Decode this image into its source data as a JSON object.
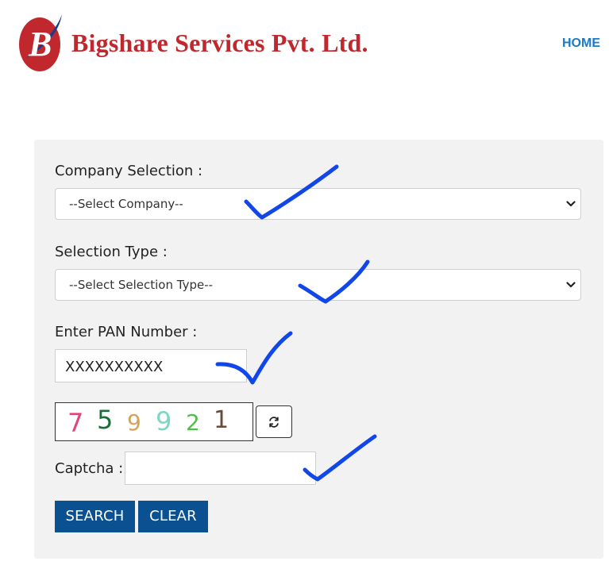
{
  "header": {
    "brand_name": "Bigshare Services Pvt. Ltd.",
    "logo_letter": "B",
    "nav": {
      "home_label": "HOME"
    }
  },
  "form": {
    "company": {
      "label": "Company Selection :",
      "selected": "--Select Company--"
    },
    "selection_type": {
      "label": "Selection Type :",
      "selected": "--Select Selection Type--"
    },
    "pan": {
      "label": "Enter PAN Number :",
      "value": "XXXXXXXXXX"
    },
    "captcha_image": {
      "digits": [
        {
          "char": "7",
          "color": "#e0457b"
        },
        {
          "char": "5",
          "color": "#1e6e3a"
        },
        {
          "char": "9",
          "color": "#d4a35a"
        },
        {
          "char": "9",
          "color": "#7fd6c4"
        },
        {
          "char": "2",
          "color": "#4fbf4a"
        },
        {
          "char": "1",
          "color": "#6b4a3a"
        }
      ]
    },
    "captcha": {
      "label": "Captcha :",
      "value": ""
    },
    "buttons": {
      "search_label": "SEARCH",
      "clear_label": "CLEAR"
    }
  },
  "colors": {
    "brand_red": "#c0282d",
    "nav_blue": "#1a7ac8",
    "button_blue": "#0b5090",
    "panel_bg": "#f2f2f2",
    "annotation_blue": "#1146e8"
  },
  "icons": {
    "select_arrow": "chevron-down-icon",
    "refresh": "refresh-icon",
    "annotation": "checkmark-icon"
  }
}
